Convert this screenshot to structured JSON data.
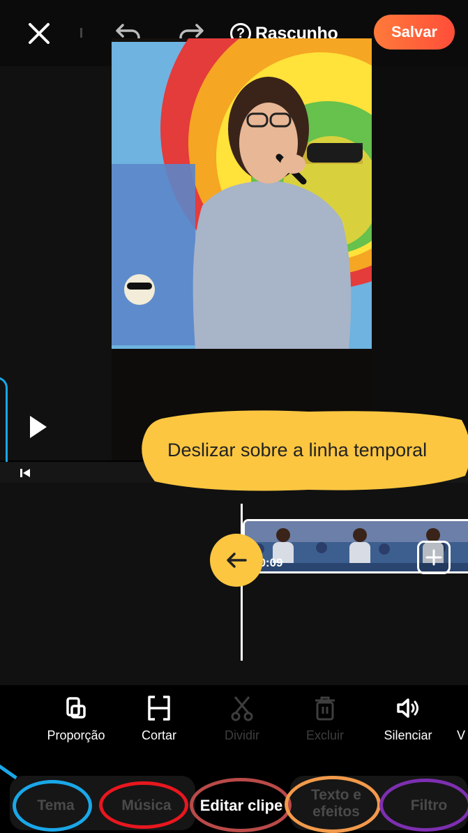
{
  "topbar": {
    "draft_label": "Rascunho",
    "help_glyph": "?",
    "save_label": "Salvar",
    "save_color": "#ff5a3a"
  },
  "timeline": {
    "hint_text": "Deslizar sobre a linha temporal",
    "clip_duration": "00:09",
    "hint_color": "#fcc640"
  },
  "toolbar": {
    "items": [
      {
        "label": "Proporção",
        "icon": "aspect-ratio-icon",
        "enabled": true
      },
      {
        "label": "Cortar",
        "icon": "trim-icon",
        "enabled": true
      },
      {
        "label": "Dividir",
        "icon": "scissors-icon",
        "enabled": false
      },
      {
        "label": "Excluir",
        "icon": "trash-icon",
        "enabled": false
      },
      {
        "label": "Silenciar",
        "icon": "speaker-icon",
        "enabled": true
      },
      {
        "label": "V",
        "icon": "",
        "enabled": true
      }
    ]
  },
  "tabs": [
    {
      "label": "Tema",
      "active": false,
      "ring_color": "#1aa7e8"
    },
    {
      "label": "Música",
      "active": false,
      "ring_color": "#e8171f"
    },
    {
      "label": "Editar clipe",
      "active": true,
      "ring_color": "#b94a48"
    },
    {
      "label": "Texto e efeitos",
      "label_line1": "Texto e",
      "label_line2": "efeitos",
      "active": false,
      "ring_color": "#f29a4b"
    },
    {
      "label": "Filtro",
      "active": false,
      "ring_color": "#7d2fb0"
    }
  ]
}
